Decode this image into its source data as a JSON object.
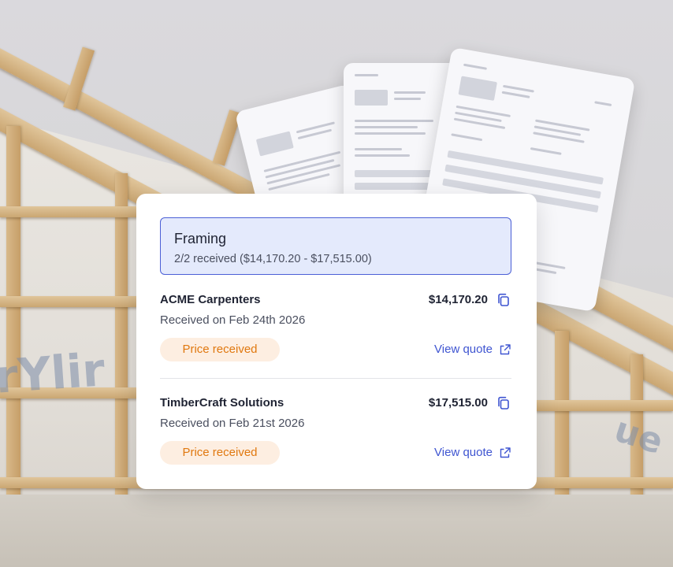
{
  "section": {
    "title": "Framing",
    "summary": "2/2 received ($14,170.20 - $17,515.00)"
  },
  "quotes": [
    {
      "name": "ACME Carpenters",
      "received": "Received on Feb 24th  2026",
      "amount": "$14,170.20",
      "status": "Price received",
      "link": "View quote"
    },
    {
      "name": "TimberCraft Solutions",
      "received": "Received on Feb 21st  2026",
      "amount": "$17,515.00",
      "status": "Price received",
      "link": "View quote"
    }
  ],
  "background_print": [
    "rYlir",
    "ue"
  ],
  "colors": {
    "accent": "#3f55d1",
    "summary_bg": "#e4eafc",
    "badge_bg": "#fdeee1",
    "badge_text": "#e0780f"
  },
  "icons": [
    "copy-icon",
    "external-link-icon"
  ]
}
